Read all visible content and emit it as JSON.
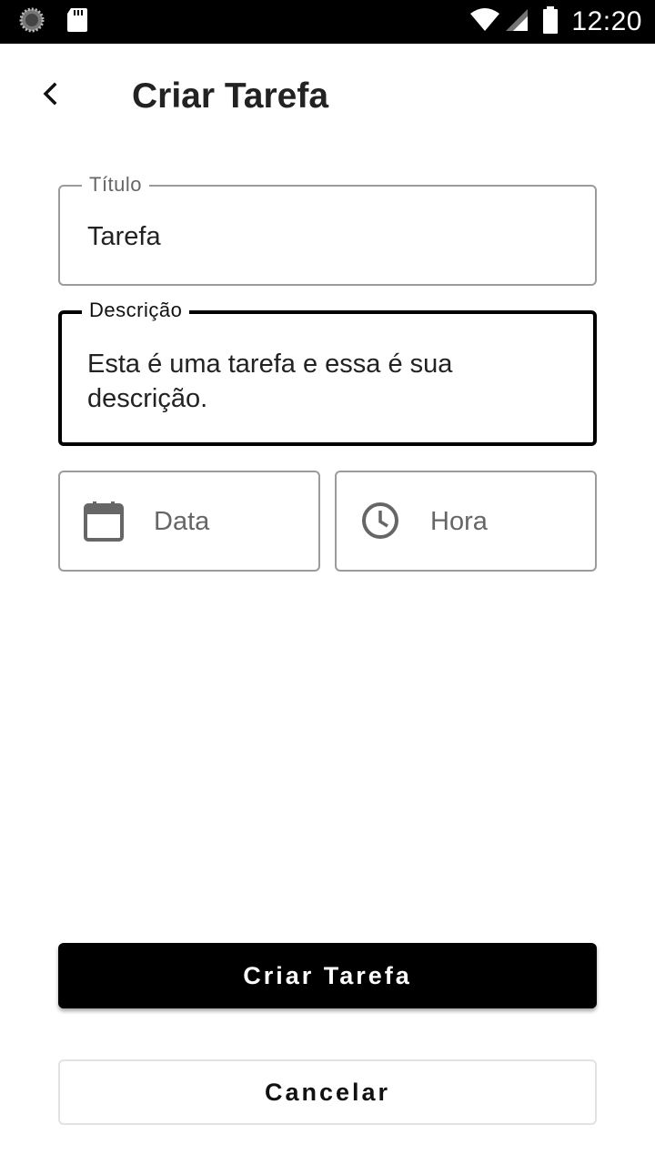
{
  "status_bar": {
    "time": "12:20",
    "icons": [
      "sync-icon",
      "sd-card-icon",
      "wifi-icon",
      "signal-icon",
      "battery-icon"
    ]
  },
  "app_bar": {
    "back_icon": "chevron-left-icon",
    "title": "Criar Tarefa"
  },
  "form": {
    "title_field": {
      "label": "Título",
      "value": "Tarefa"
    },
    "description_field": {
      "label": "Descrição",
      "value": "Esta é uma tarefa e essa é sua descrição.",
      "focused": true
    },
    "date_picker": {
      "icon": "calendar-icon",
      "placeholder": "Data"
    },
    "time_picker": {
      "icon": "clock-icon",
      "placeholder": "Hora"
    }
  },
  "actions": {
    "create_label": "Criar Tarefa",
    "cancel_label": "Cancelar"
  },
  "colors": {
    "primary": "#000000",
    "outline": "#9b9b9b",
    "hint_text": "#666666"
  }
}
